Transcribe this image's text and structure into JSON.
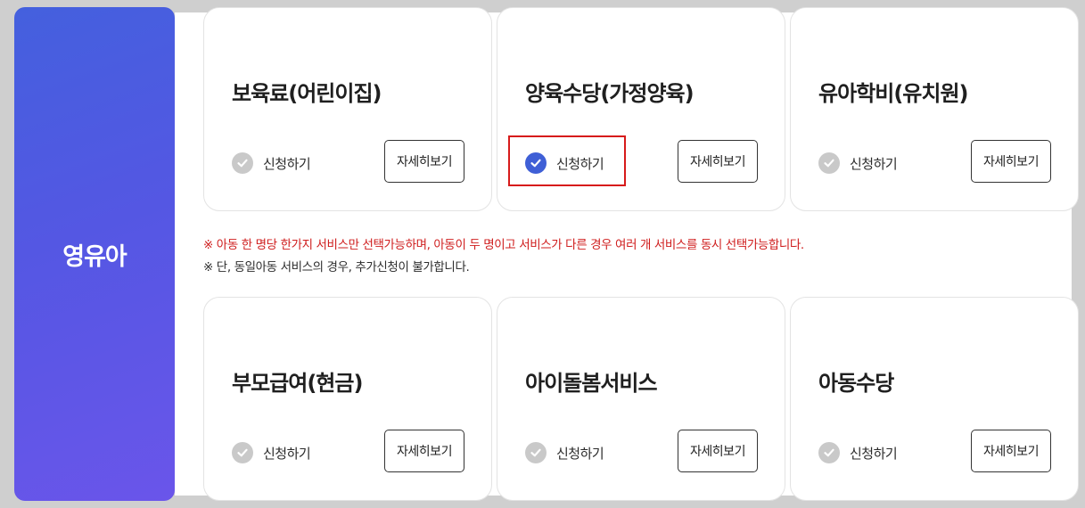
{
  "sidebar": {
    "title": "영유아"
  },
  "services_top": [
    {
      "title": "보육료(어린이집)",
      "apply_label": "신청하기",
      "detail_label": "자세히보기",
      "checked": false
    },
    {
      "title": "양육수당(가정양육)",
      "apply_label": "신청하기",
      "detail_label": "자세히보기",
      "checked": true
    },
    {
      "title": "유아학비(유치원)",
      "apply_label": "신청하기",
      "detail_label": "자세히보기",
      "checked": false
    }
  ],
  "services_bottom": [
    {
      "title": "부모급여(현금)",
      "apply_label": "신청하기",
      "detail_label": "자세히보기",
      "checked": false
    },
    {
      "title": "아이돌봄서비스",
      "apply_label": "신청하기",
      "detail_label": "자세히보기",
      "checked": false
    },
    {
      "title": "아동수당",
      "apply_label": "신청하기",
      "detail_label": "자세히보기",
      "checked": false
    }
  ],
  "notes": {
    "red": "※ 아동 한 명당 한가지 서비스만 선택가능하며, 아동이 두 명이고 서비스가 다른 경우 여러 개 서비스를 동시 선택가능합니다.",
    "dark": "※ 단, 동일아동 서비스의 경우, 추가신청이 불가합니다."
  },
  "icons": {
    "check": "check-circle-icon"
  },
  "colors": {
    "accent": "#3f5fd6",
    "unchecked": "#c9c9c9",
    "notice_red": "#cf1d1d",
    "highlight_box": "#d71b1b",
    "sidebar_gradient_start": "#4460de",
    "sidebar_gradient_end": "#6a55ea"
  }
}
